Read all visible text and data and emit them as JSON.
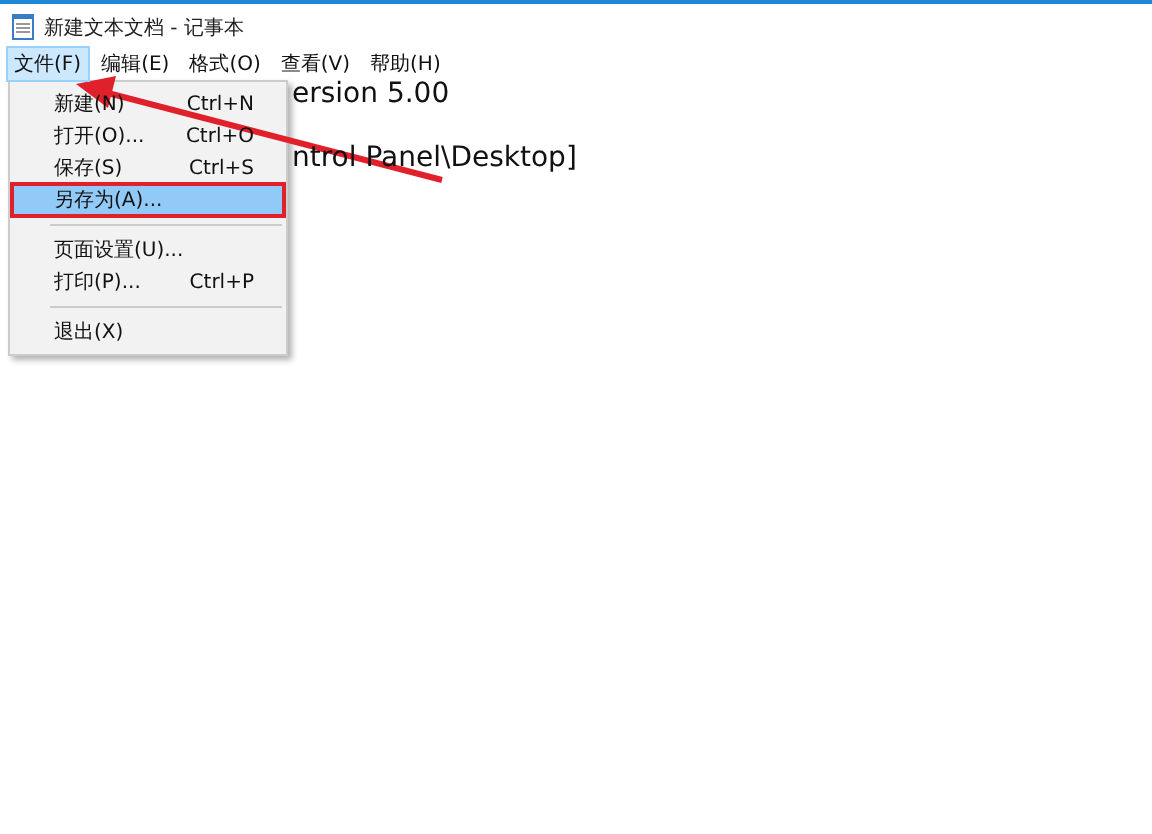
{
  "window": {
    "title": "新建文本文档 - 记事本"
  },
  "menu_bar": [
    {
      "label": "文件(F)",
      "selected": true
    },
    {
      "label": "编辑(E)",
      "selected": false
    },
    {
      "label": "格式(O)",
      "selected": false
    },
    {
      "label": "查看(V)",
      "selected": false
    },
    {
      "label": "帮助(H)",
      "selected": false
    }
  ],
  "file_menu": [
    {
      "kind": "item",
      "label": "新建(N)",
      "shortcut": "Ctrl+N",
      "selected": false
    },
    {
      "kind": "item",
      "label": "打开(O)...",
      "shortcut": "Ctrl+O",
      "selected": false
    },
    {
      "kind": "item",
      "label": "保存(S)",
      "shortcut": "Ctrl+S",
      "selected": false
    },
    {
      "kind": "item",
      "label": "另存为(A)...",
      "selected": true
    },
    {
      "kind": "separator"
    },
    {
      "kind": "item",
      "label": "页面设置(U)...",
      "selected": false
    },
    {
      "kind": "item",
      "label": "打印(P)...",
      "shortcut": "Ctrl+P",
      "selected": false
    },
    {
      "kind": "separator"
    },
    {
      "kind": "item",
      "label": "退出(X)",
      "selected": false
    }
  ],
  "editor_lines": [
    "ersion 5.00",
    "ntrol Panel\\Desktop]"
  ]
}
